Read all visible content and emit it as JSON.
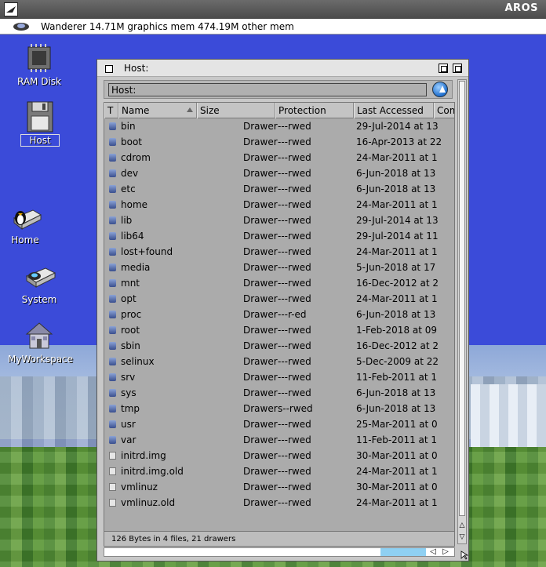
{
  "topbar": {
    "title": "AROS"
  },
  "menubar": {
    "status": "Wanderer 14.71M graphics mem 474.19M other mem"
  },
  "desktop": {
    "icons": [
      {
        "label": "RAM Disk"
      },
      {
        "label": "Host"
      },
      {
        "label": "Home"
      },
      {
        "label": "System"
      },
      {
        "label": "MyWorkspace"
      }
    ]
  },
  "window": {
    "title": "Host:",
    "path": "Host:",
    "columns": [
      "T",
      "Name",
      "Size",
      "Protection",
      "Last Accessed",
      "Com"
    ],
    "rows": [
      {
        "type": "drawer",
        "name": "bin",
        "size": "Drawer",
        "prot": "---rwed",
        "date": "29-Jul-2014 at 13"
      },
      {
        "type": "drawer",
        "name": "boot",
        "size": "Drawer",
        "prot": "---rwed",
        "date": "16-Apr-2013 at 22"
      },
      {
        "type": "drawer",
        "name": "cdrom",
        "size": "Drawer",
        "prot": "---rwed",
        "date": "24-Mar-2011 at 1"
      },
      {
        "type": "drawer",
        "name": "dev",
        "size": "Drawer",
        "prot": "---rwed",
        "date": "6-Jun-2018 at 13"
      },
      {
        "type": "drawer",
        "name": "etc",
        "size": "Drawer",
        "prot": "---rwed",
        "date": "6-Jun-2018 at 13"
      },
      {
        "type": "drawer",
        "name": "home",
        "size": "Drawer",
        "prot": "---rwed",
        "date": "24-Mar-2011 at 1"
      },
      {
        "type": "drawer",
        "name": "lib",
        "size": "Drawer",
        "prot": "---rwed",
        "date": "29-Jul-2014 at 13"
      },
      {
        "type": "drawer",
        "name": "lib64",
        "size": "Drawer",
        "prot": "---rwed",
        "date": "29-Jul-2014 at 11"
      },
      {
        "type": "drawer",
        "name": "lost+found",
        "size": "Drawer",
        "prot": "---rwed",
        "date": "24-Mar-2011 at 1"
      },
      {
        "type": "drawer",
        "name": "media",
        "size": "Drawer",
        "prot": "---rwed",
        "date": "5-Jun-2018 at 17"
      },
      {
        "type": "drawer",
        "name": "mnt",
        "size": "Drawer",
        "prot": "---rwed",
        "date": "16-Dec-2012 at 2"
      },
      {
        "type": "drawer",
        "name": "opt",
        "size": "Drawer",
        "prot": "---rwed",
        "date": "24-Mar-2011 at 1"
      },
      {
        "type": "drawer",
        "name": "proc",
        "size": "Drawer",
        "prot": "---r-ed",
        "date": "6-Jun-2018 at 13"
      },
      {
        "type": "drawer",
        "name": "root",
        "size": "Drawer",
        "prot": "---rwed",
        "date": "1-Feb-2018 at 09"
      },
      {
        "type": "drawer",
        "name": "sbin",
        "size": "Drawer",
        "prot": "---rwed",
        "date": "16-Dec-2012 at 2"
      },
      {
        "type": "drawer",
        "name": "selinux",
        "size": "Drawer",
        "prot": "---rwed",
        "date": "5-Dec-2009 at 22"
      },
      {
        "type": "drawer",
        "name": "srv",
        "size": "Drawer",
        "prot": "---rwed",
        "date": "11-Feb-2011 at 1"
      },
      {
        "type": "drawer",
        "name": "sys",
        "size": "Drawer",
        "prot": "---rwed",
        "date": "6-Jun-2018 at 13"
      },
      {
        "type": "drawer",
        "name": "tmp",
        "size": "Drawer",
        "prot": "s--rwed",
        "date": "6-Jun-2018 at 13"
      },
      {
        "type": "drawer",
        "name": "usr",
        "size": "Drawer",
        "prot": "---rwed",
        "date": "25-Mar-2011 at 0"
      },
      {
        "type": "drawer",
        "name": "var",
        "size": "Drawer",
        "prot": "---rwed",
        "date": "11-Feb-2011 at 1"
      },
      {
        "type": "file",
        "name": "initrd.img",
        "size": "Drawer",
        "prot": "---rwed",
        "date": "30-Mar-2011 at 0"
      },
      {
        "type": "file",
        "name": "initrd.img.old",
        "size": "Drawer",
        "prot": "---rwed",
        "date": "24-Mar-2011 at 1"
      },
      {
        "type": "file",
        "name": "vmlinuz",
        "size": "Drawer",
        "prot": "---rwed",
        "date": "30-Mar-2011 at 0"
      },
      {
        "type": "file",
        "name": "vmlinuz.old",
        "size": "Drawer",
        "prot": "---rwed",
        "date": "24-Mar-2011 at 1"
      }
    ],
    "status": "126 Bytes in 4 files, 21 drawers"
  },
  "colors": {
    "desktop": "#3b4bd9",
    "accent": "#8fd0f2"
  }
}
